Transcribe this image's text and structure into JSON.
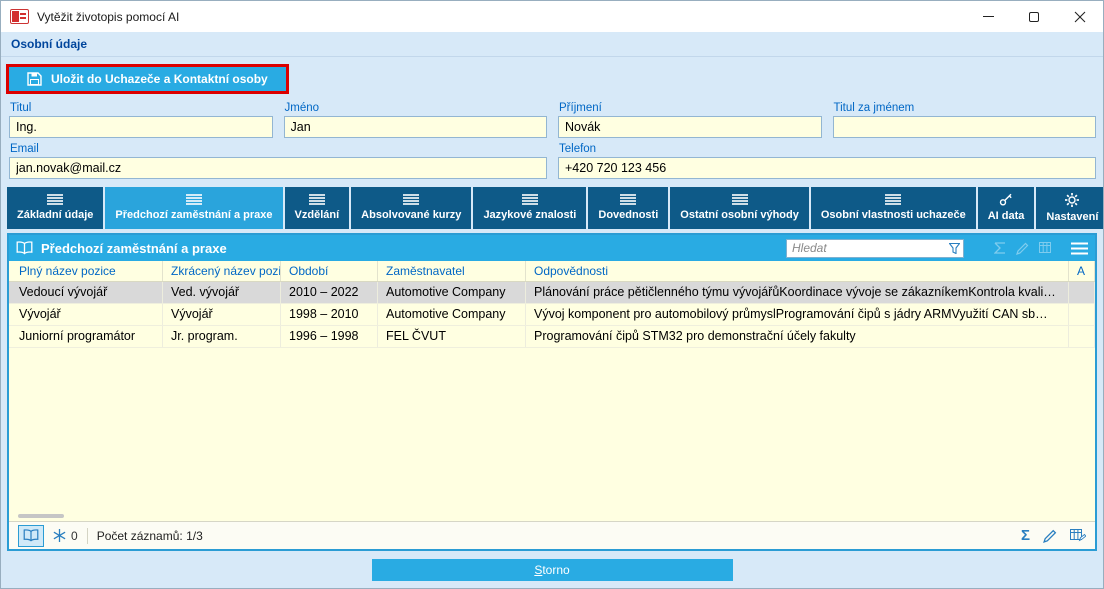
{
  "colors": {
    "accent": "#29abe3",
    "tab_dark": "#0e5a88",
    "field_bg": "#ffffe1",
    "label_blue": "#0067c5",
    "highlight_red": "#dc0000",
    "selected_row_bg": "#d9d9d9"
  },
  "titlebar": {
    "title": "Vytěžit životopis pomocí AI"
  },
  "section": {
    "title": "Osobní údaje"
  },
  "actions": {
    "save_label": "Uložit do Uchazeče a Kontaktní osoby",
    "cancel_label": "Storno"
  },
  "form": {
    "titul": {
      "label": "Titul",
      "value": "Ing."
    },
    "jmeno": {
      "label": "Jméno",
      "value": "Jan"
    },
    "prijmeni": {
      "label": "Příjmení",
      "value": "Novák"
    },
    "titul_za_jmenem": {
      "label": "Titul za jménem",
      "value": ""
    },
    "email": {
      "label": "Email",
      "value": "jan.novak@mail.cz"
    },
    "telefon": {
      "label": "Telefon",
      "value": "+420 720 123 456"
    }
  },
  "tabs": [
    {
      "label": "Základní údaje",
      "icon": "list",
      "active": false
    },
    {
      "label": "Předchozí zaměstnání a praxe",
      "icon": "list",
      "active": true
    },
    {
      "label": "Vzdělání",
      "icon": "list",
      "active": false
    },
    {
      "label": "Absolvované kurzy",
      "icon": "list",
      "active": false
    },
    {
      "label": "Jazykové znalosti",
      "icon": "list",
      "active": false
    },
    {
      "label": "Dovednosti",
      "icon": "list",
      "active": false
    },
    {
      "label": "Ostatní osobní výhody",
      "icon": "list",
      "active": false
    },
    {
      "label": "Osobní vlastnosti uchazeče",
      "icon": "list",
      "active": false
    },
    {
      "label": "AI data",
      "icon": "key",
      "active": false
    },
    {
      "label": "Nastavení",
      "icon": "gear",
      "active": false
    }
  ],
  "panel": {
    "title": "Předchozí zaměstnání a praxe",
    "search_placeholder": "Hledat"
  },
  "table": {
    "columns": [
      "Plný název pozice",
      "Zkrácený název pozice",
      "Období",
      "Zaměstnavatel",
      "Odpovědnosti",
      "A"
    ],
    "rows": [
      {
        "selected": true,
        "cells": [
          "Vedoucí vývojář",
          "Ved. vývojář",
          "2010 – 2022",
          "Automotive Company",
          "Plánování práce pětičlenného týmu vývojářůKoordinace vývoje se zákazníkemKontrola kvali…",
          ""
        ]
      },
      {
        "selected": false,
        "cells": [
          "Vývojář",
          "Vývojář",
          "1998 – 2010",
          "Automotive Company",
          "Vývoj komponent pro automobilový průmyslProgramování čipů s jádry ARMVyužití CAN sb…",
          ""
        ]
      },
      {
        "selected": false,
        "cells": [
          "Juniorní programátor",
          "Jr. program.",
          "1996 – 1998",
          "FEL ČVUT",
          "Programování čipů STM32 pro demonstrační účely fakulty",
          ""
        ]
      }
    ]
  },
  "status": {
    "freeze_count": "0",
    "records": "Počet záznamů: 1/3",
    "sum_symbol": "Σ"
  }
}
